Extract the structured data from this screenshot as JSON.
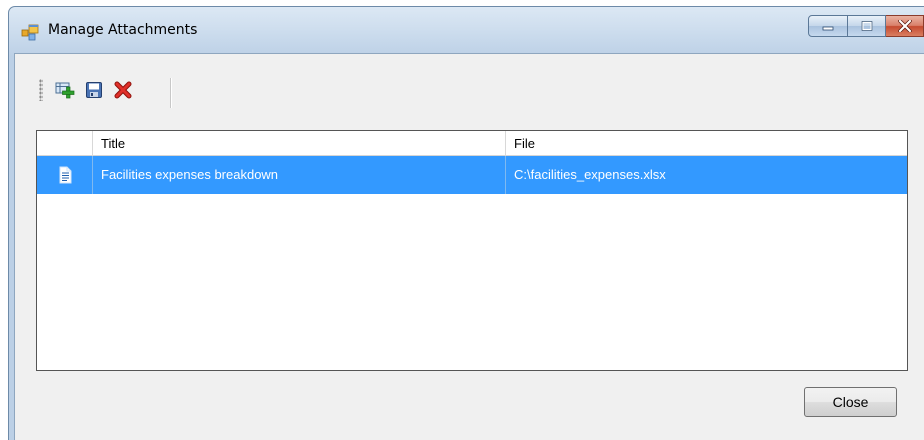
{
  "window": {
    "title": "Manage Attachments",
    "icon": "app-window-icon",
    "controls": [
      "minimize-icon",
      "maximize-icon",
      "close-icon"
    ]
  },
  "toolbar": {
    "buttons": [
      {
        "name": "add-attachment-button",
        "icon": "add-icon"
      },
      {
        "name": "save-attachment-button",
        "icon": "save-icon"
      },
      {
        "name": "delete-attachment-button",
        "icon": "delete-icon"
      }
    ]
  },
  "grid": {
    "columns": [
      "",
      "Title",
      "File"
    ],
    "rows": [
      {
        "icon": "document-icon",
        "title": "Facilities expenses breakdown",
        "file": "C:\\facilities_expenses.xlsx",
        "selected": true
      }
    ]
  },
  "footer": {
    "close_label": "Close"
  },
  "colors": {
    "selection": "#3399ff",
    "client_bg": "#f0f0f0",
    "delete_red": "#d9261c"
  }
}
